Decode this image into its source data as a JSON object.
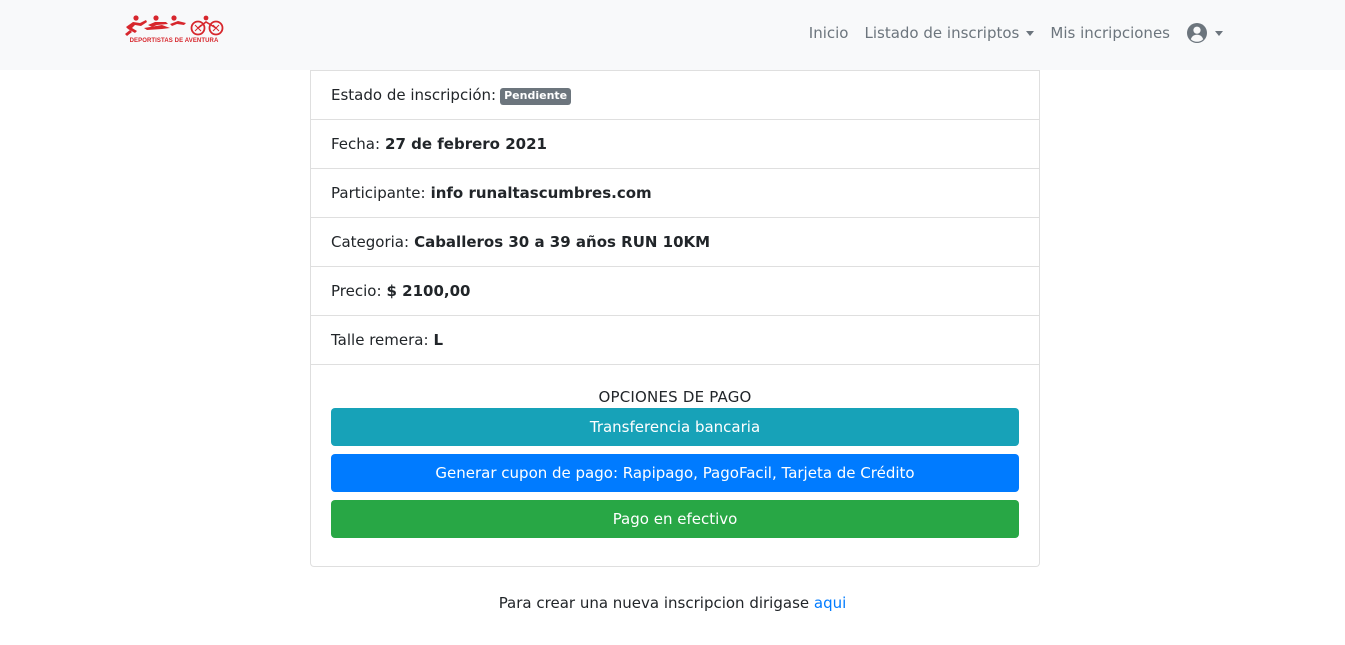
{
  "navbar": {
    "logo_text": "DEPORTISTAS DE AVENTURA",
    "links": {
      "inicio": "Inicio",
      "listado": "Listado de inscriptos",
      "mis_inscripciones": "Mis incripciones"
    },
    "user_icon": "user-circle-icon"
  },
  "inscription": {
    "estado": {
      "label": "Estado de inscripción:",
      "value": "Pendiente"
    },
    "fecha": {
      "label": "Fecha:",
      "value": "27 de febrero 2021"
    },
    "participante": {
      "label": "Participante:",
      "value": "info runaltascumbres.com"
    },
    "categoria": {
      "label": "Categoria:",
      "value": "Caballeros 30 a 39 años RUN 10KM"
    },
    "precio": {
      "label": "Precio:",
      "value": "$ 2100,00"
    },
    "talle": {
      "label": "Talle remera:",
      "value": "L"
    }
  },
  "payment": {
    "title": "OPCIONES DE PAGO",
    "buttons": {
      "transferencia": "Transferencia bancaria",
      "cupon": "Generar cupon de pago: Rapipago, PagoFacil, Tarjeta de Crédito",
      "efectivo": "Pago en efectivo"
    }
  },
  "footer": {
    "text": "Para crear una nueva inscripcion dirigase",
    "link": "aqui"
  },
  "colors": {
    "navbar_bg": "#f8f9fa",
    "brand_red": "#d7262c",
    "badge": "#6c757d",
    "info": "#17a2b8",
    "primary": "#007bff",
    "success": "#28a745"
  }
}
